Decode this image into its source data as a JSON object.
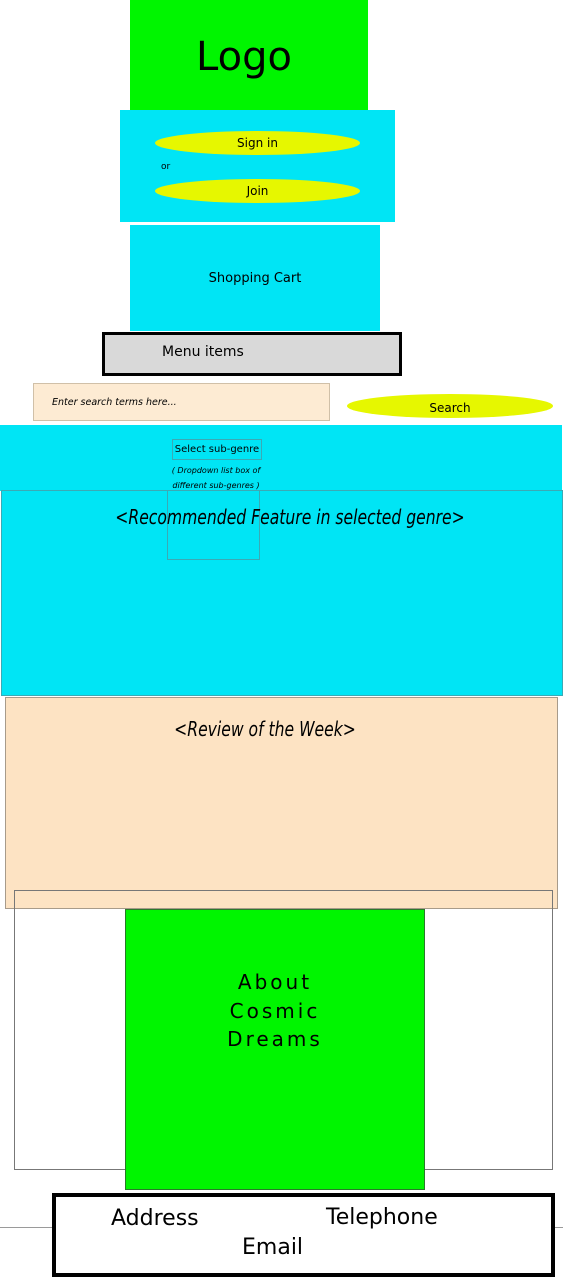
{
  "header": {
    "logo_text": "Logo"
  },
  "auth": {
    "sign_in_label": "Sign in",
    "or_text": "or",
    "join_label": "Join"
  },
  "cart": {
    "label": "Shopping Cart"
  },
  "menu": {
    "label": "Menu items"
  },
  "search": {
    "placeholder": "Enter search terms here...",
    "button_label": "Search"
  },
  "subgenre": {
    "select_label": "Select sub-genre",
    "note": "( Dropdown list box of different sub-genres )"
  },
  "feature": {
    "title": "<Recommended Feature in selected genre>"
  },
  "review": {
    "title": "<Review of the Week>"
  },
  "about": {
    "text": "About\nCosmic\nDreams"
  },
  "footer": {
    "address": "Address",
    "telephone": "Telephone",
    "email": "Email"
  },
  "colors": {
    "green": "#00f500",
    "cyan": "#00e5f5",
    "yellow": "#e6f700",
    "peach": "#fde3c3",
    "grey": "#d9d9d9"
  }
}
